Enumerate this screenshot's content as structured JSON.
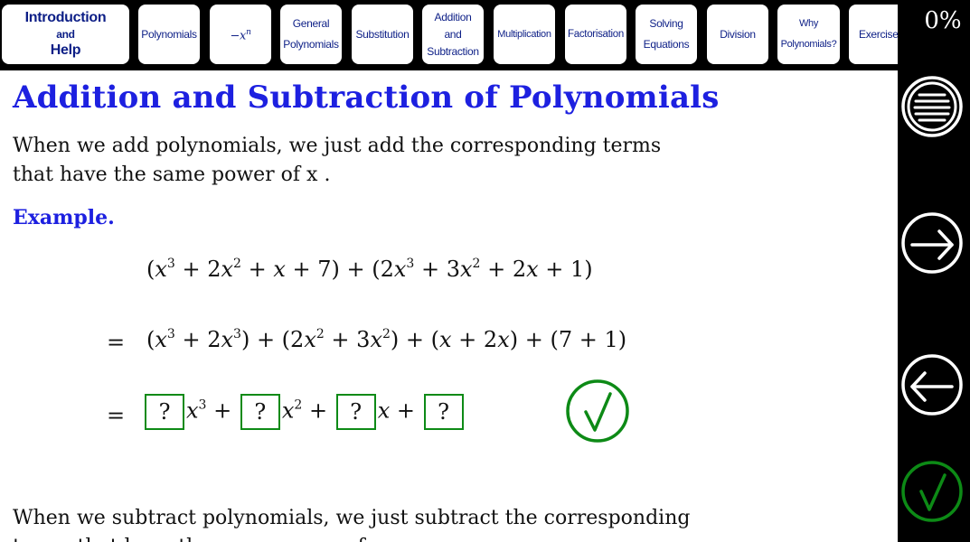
{
  "nav": {
    "intro": {
      "line1": "Introduction",
      "line2": "and",
      "line3": "Help"
    },
    "polynomials": "Polynomials",
    "negx_base": "−x",
    "negx_exp": "n",
    "general": {
      "line1": "General",
      "line2": "Polynomials"
    },
    "substitution": "Substitution",
    "addition": {
      "line1": "Addition",
      "line2": "and",
      "line3": "Subtraction"
    },
    "multiplication": "Multiplication",
    "factorisation": "Factorisation",
    "solving": {
      "line1": "Solving",
      "line2": "Equations"
    },
    "division": "Division",
    "why": {
      "line1": "Why",
      "line2": "Polynomials?"
    },
    "exercises": "Exercises"
  },
  "sidebar": {
    "progress": "0%"
  },
  "main": {
    "title": "Addition and Subtraction of Polynomials",
    "intro_text": "When we add polynomials, we just add the corresponding terms that have the same power of x .",
    "example_label": "Example.",
    "eq_sign": "=",
    "answer_placeholder": "?",
    "subtract_text": "When we subtract polynomials, we just subtract the corresponding terms that have the same power of x ."
  },
  "colors": {
    "title_blue": "#1d20e0",
    "nav_text": "#0c1e86",
    "correct_green": "#0d8a16"
  },
  "icons": {
    "menu": "menu-icon",
    "next": "arrow-right-icon",
    "prev": "arrow-left-icon",
    "check": "check-icon"
  }
}
